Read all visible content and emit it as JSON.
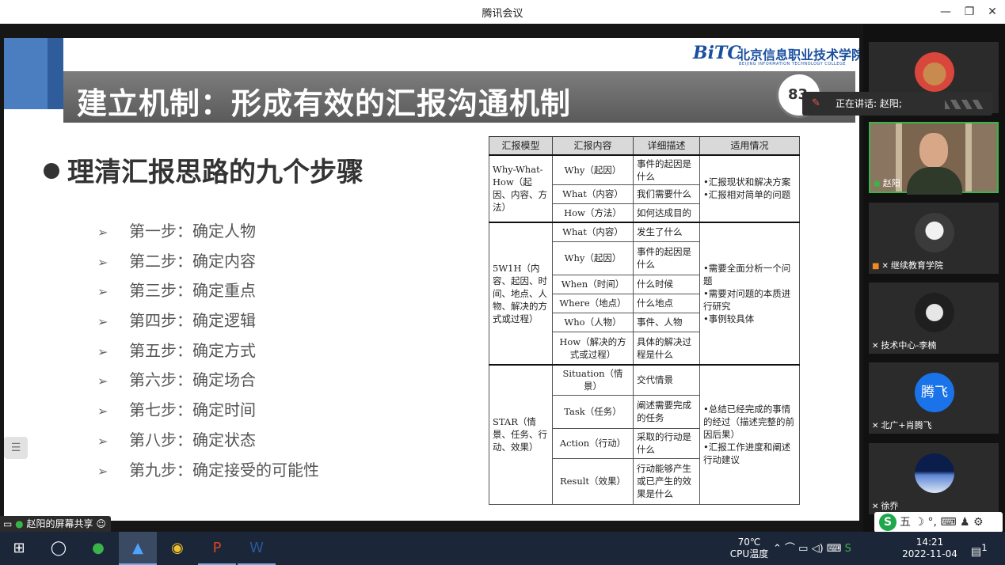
{
  "window": {
    "title": "腾讯会议",
    "min": "—",
    "restore": "❐",
    "close": "✕"
  },
  "slide": {
    "title": "建立机制：形成有效的汇报沟通机制",
    "page": "83",
    "logo_bitc": "BiTC",
    "logo_cn": "北京信息职业技术学院",
    "logo_en": "BEIJING INFORMATION TECHNOLOGY COLLEGE",
    "heading": "理清汇报思路的九个步骤",
    "step_arrow": "➢",
    "steps": [
      "第一步：确定人物",
      "第二步：确定内容",
      "第三步：确定重点",
      "第四步：确定逻辑",
      "第五步：确定方式",
      "第六步：确定场合",
      "第七步：确定时间",
      "第八步：确定状态",
      "第九步：确定接受的可能性"
    ],
    "table": {
      "headers": [
        "汇报模型",
        "汇报内容",
        "详细描述",
        "适用情况"
      ],
      "groups": [
        {
          "model": "Why-What-How（起因、内容、方法）",
          "rows": [
            [
              "Why（起因）",
              "事件的起因是什么"
            ],
            [
              "What（内容）",
              "我们需要什么"
            ],
            [
              "How（方法）",
              "如何达成目的"
            ]
          ],
          "usage": "•汇报现状和解决方案\n•汇报相对简单的问题"
        },
        {
          "model": "5W1H（内容、起因、时间、地点、人物、解决的方式或过程）",
          "rows": [
            [
              "What（内容）",
              "发生了什么"
            ],
            [
              "Why（起因）",
              "事件的起因是什么"
            ],
            [
              "When（时间）",
              "什么时候"
            ],
            [
              "Where（地点）",
              "什么地点"
            ],
            [
              "Who（人物）",
              "事件、人物"
            ],
            [
              "How（解决的方式或过程）",
              "具体的解决过程是什么"
            ]
          ],
          "usage": "•需要全面分析一个问题\n•需要对问题的本质进行研究\n•事例较具体"
        },
        {
          "model": "STAR（情景、任务、行动、效果）",
          "rows": [
            [
              "Situation（情景）",
              "交代情景"
            ],
            [
              "Task（任务）",
              "阐述需要完成的任务"
            ],
            [
              "Action（行动）",
              "采取的行动是什么"
            ],
            [
              "Result（效果）",
              "行动能够产生或已产生的效果是什么"
            ]
          ],
          "usage": "•总结已经完成的事情的经过（描述完整的前因后果）\n•汇报工作进度和阐述行动建议"
        }
      ]
    }
  },
  "share_label": "赵阳的屏幕共享",
  "speaking": "正在讲话: 赵阳;",
  "participants": [
    {
      "name": "",
      "avatar": "teddy-bear"
    },
    {
      "name": "赵阳",
      "avatar": "camera-video"
    },
    {
      "name": "继续教育学院",
      "avatar": "cartoon-man"
    },
    {
      "name": "技术中心-李楠",
      "avatar": "robot"
    },
    {
      "name": "北广+肖腾飞",
      "avatar": "text",
      "avatar_text": "腾飞",
      "avatar_color": "#1a73e8"
    },
    {
      "name": "徐乔",
      "avatar": "earth-horizon"
    }
  ],
  "ime": {
    "logo": "S",
    "items": "五 ☽ °, ⌨ ♟ ⚙"
  },
  "taskbar": {
    "temperature": "70℃",
    "cpu_label": "CPU温度",
    "time": "14:21",
    "date": "2022-11-04",
    "notification_count": "1"
  }
}
